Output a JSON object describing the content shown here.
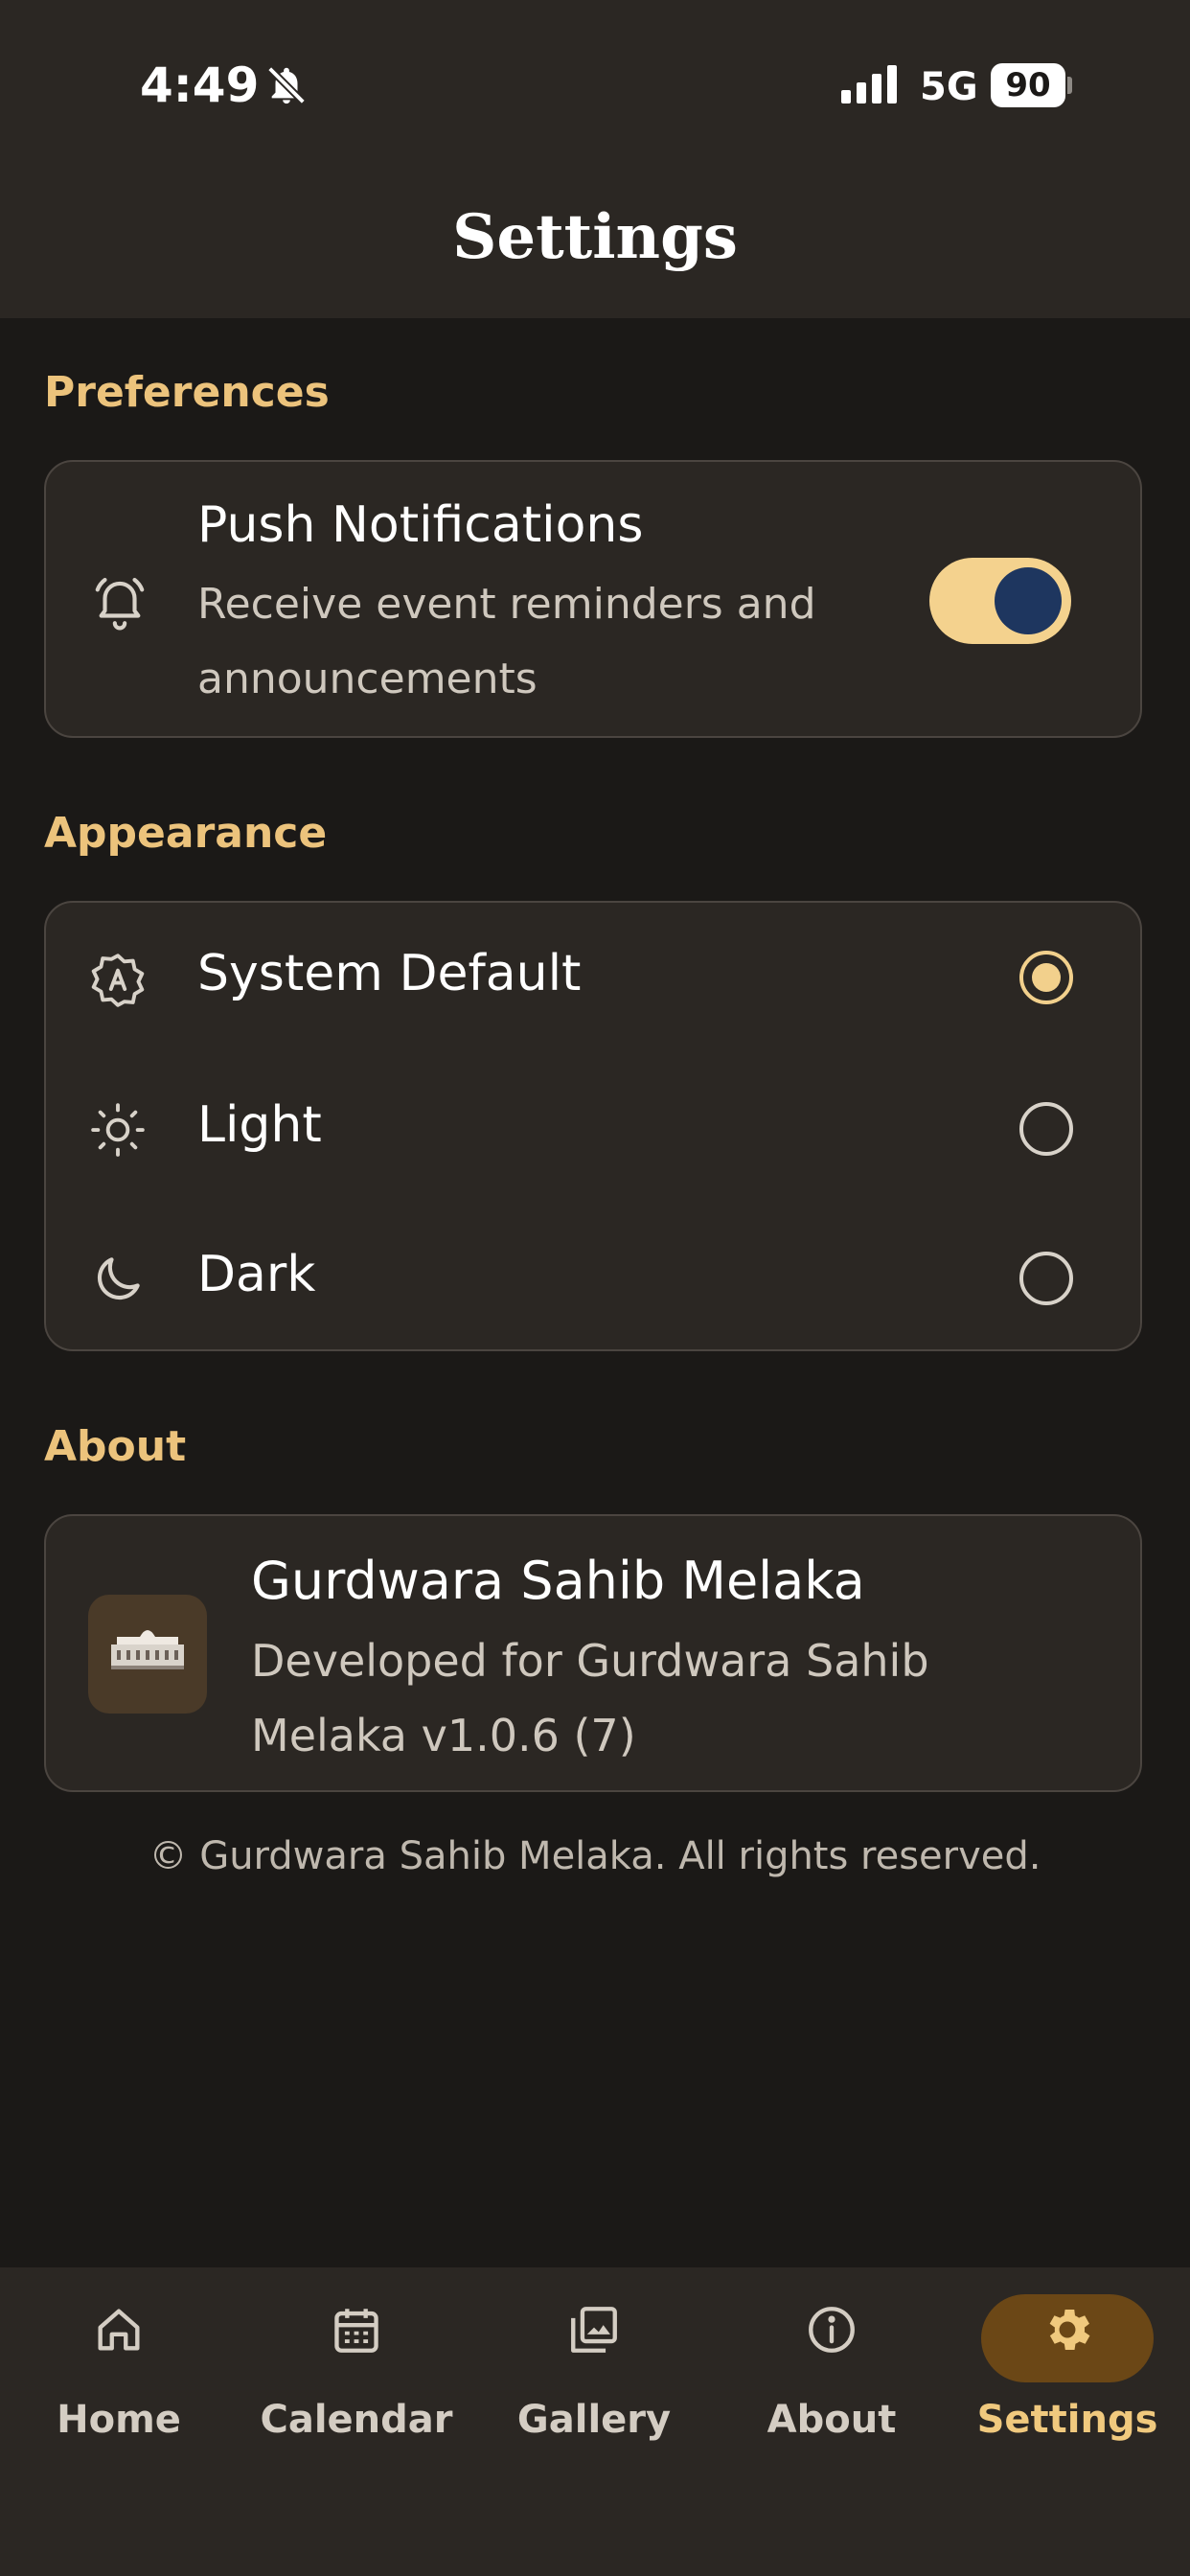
{
  "status_bar": {
    "time": "4:49",
    "network": "5G",
    "battery": "90"
  },
  "header": {
    "title": "Settings"
  },
  "preferences": {
    "section_label": "Preferences",
    "push": {
      "title": "Push Notifications",
      "description": "Receive event reminders and announcements",
      "enabled": true,
      "icon": "bell-icon"
    }
  },
  "appearance": {
    "section_label": "Appearance",
    "options": [
      {
        "label": "System Default",
        "icon": "auto-theme-icon",
        "selected": true
      },
      {
        "label": "Light",
        "icon": "sun-icon",
        "selected": false
      },
      {
        "label": "Dark",
        "icon": "moon-icon",
        "selected": false
      }
    ]
  },
  "about": {
    "section_label": "About",
    "app_name": "Gurdwara Sahib Melaka",
    "description": "Developed for Gurdwara Sahib Melaka v1.0.6 (7)",
    "copyright": "© Gurdwara Sahib Melaka. All rights reserved."
  },
  "tabs": [
    {
      "label": "Home",
      "icon": "home-icon",
      "active": false
    },
    {
      "label": "Calendar",
      "icon": "calendar-icon",
      "active": false
    },
    {
      "label": "Gallery",
      "icon": "gallery-icon",
      "active": false
    },
    {
      "label": "About",
      "icon": "info-icon",
      "active": false
    },
    {
      "label": "Settings",
      "icon": "gear-icon",
      "active": true
    }
  ],
  "colors": {
    "accent": "#ECC37C",
    "background": "#1B1917",
    "card": "#2B2723",
    "active_tab_pill": "#6B4716",
    "toggle_knob": "#1E365F"
  }
}
